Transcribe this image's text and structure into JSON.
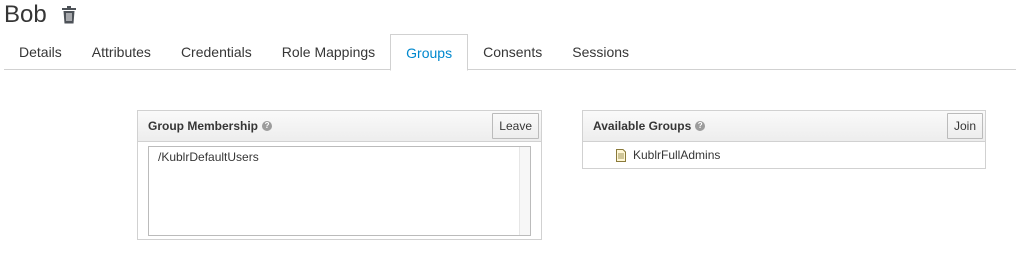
{
  "user": {
    "name": "Bob"
  },
  "tabs": [
    {
      "label": "Details"
    },
    {
      "label": "Attributes"
    },
    {
      "label": "Credentials"
    },
    {
      "label": "Role Mappings"
    },
    {
      "label": "Groups"
    },
    {
      "label": "Consents"
    },
    {
      "label": "Sessions"
    }
  ],
  "active_tab": "Groups",
  "group_membership": {
    "title": "Group Membership",
    "leave_label": "Leave",
    "items": [
      "/KublrDefaultUsers"
    ]
  },
  "available_groups": {
    "title": "Available Groups",
    "join_label": "Join",
    "items": [
      "KublrFullAdmins"
    ]
  },
  "colors": {
    "accent": "#0088ce",
    "border": "#d1d1d1",
    "text": "#363636"
  },
  "icons": {
    "delete": "trash-icon",
    "help": "help-icon",
    "group": "file-icon"
  }
}
